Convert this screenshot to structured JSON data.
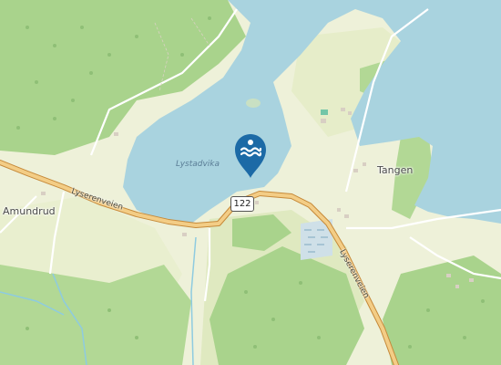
{
  "map": {
    "colors": {
      "water": "#a9d3df",
      "forest": "#a9d38c",
      "meadow": "#e9efcf",
      "road_casing": "#c68a3a",
      "road_fill": "#f3cd86",
      "pin": "#1c6aa6"
    },
    "labels": {
      "water_name": "Lystadvika",
      "place_west": "Amundrud",
      "place_east": "Tangen",
      "road_west": "Lyserenveien",
      "road_east": "Lyserenveien",
      "route_number": "122"
    },
    "marker": {
      "icon": "swimming-icon"
    }
  }
}
